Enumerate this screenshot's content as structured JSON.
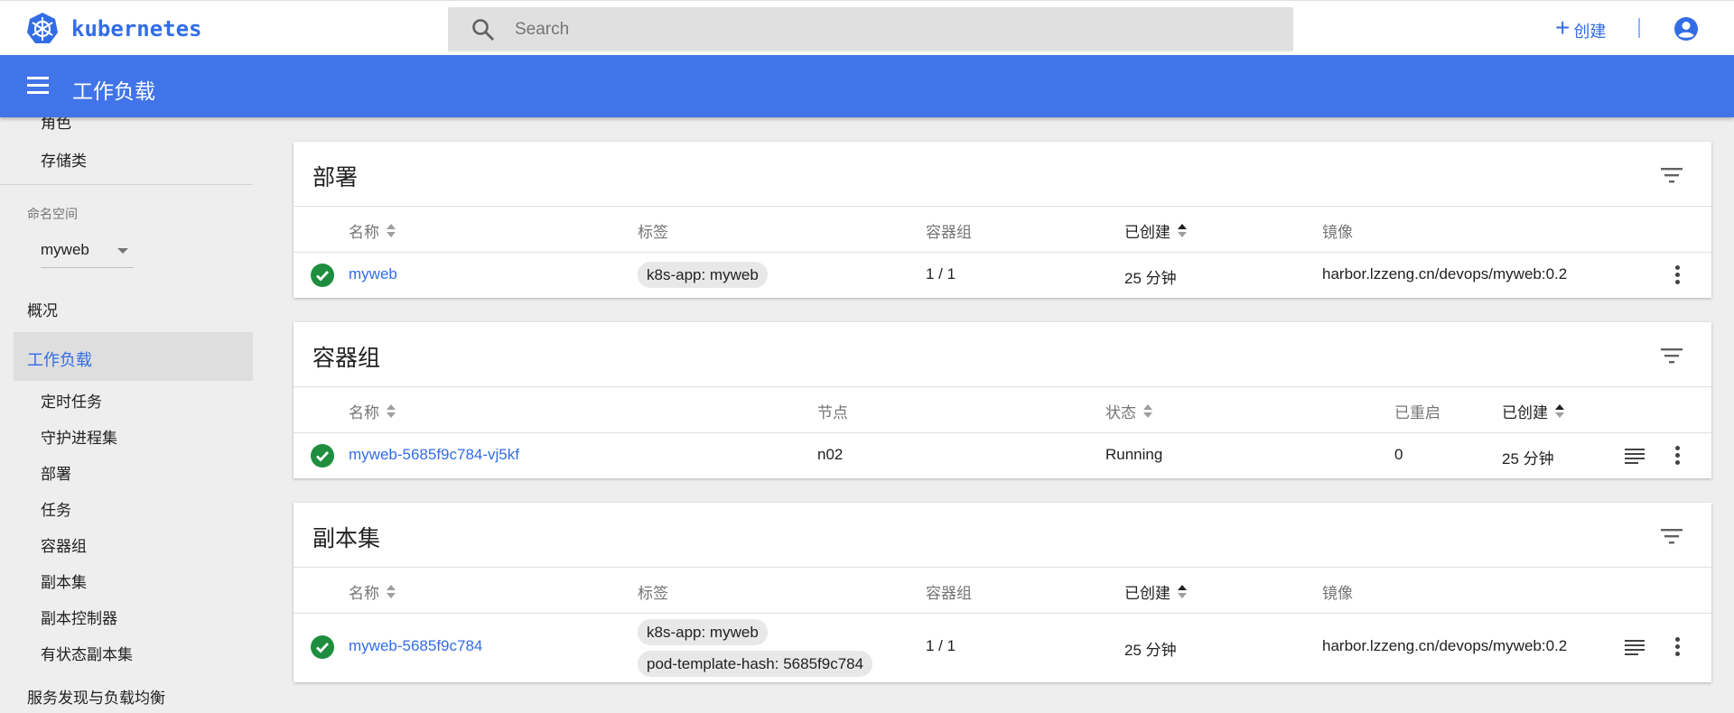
{
  "topbar": {
    "brand": "kubernetes",
    "search_placeholder": "Search",
    "create_label": "创建"
  },
  "appbar": {
    "title": "工作负载"
  },
  "sidebar": {
    "partial_top_item": "角色",
    "storage_class": "存储类",
    "namespace_label": "命名空间",
    "namespace_value": "myweb",
    "overview": "概况",
    "workloads": "工作负载",
    "workload_items": [
      "定时任务",
      "守护进程集",
      "部署",
      "任务",
      "容器组",
      "副本集",
      "副本控制器",
      "有状态副本集"
    ],
    "discovery": "服务发现与负载均衡"
  },
  "deployments": {
    "title": "部署",
    "headers": {
      "name": "名称",
      "labels": "标签",
      "pods": "容器组",
      "created": "已创建",
      "images": "镜像"
    },
    "rows": [
      {
        "name": "myweb",
        "labels": [
          "k8s-app: myweb"
        ],
        "pods": "1 / 1",
        "created": "25 分钟",
        "image": "harbor.lzzeng.cn/devops/myweb:0.2"
      }
    ]
  },
  "pods": {
    "title": "容器组",
    "headers": {
      "name": "名称",
      "node": "节点",
      "status": "状态",
      "restarts": "已重启",
      "created": "已创建"
    },
    "rows": [
      {
        "name": "myweb-5685f9c784-vj5kf",
        "node": "n02",
        "status": "Running",
        "restarts": "0",
        "created": "25 分钟"
      }
    ]
  },
  "replicasets": {
    "title": "副本集",
    "headers": {
      "name": "名称",
      "labels": "标签",
      "pods": "容器组",
      "created": "已创建",
      "images": "镜像"
    },
    "rows": [
      {
        "name": "myweb-5685f9c784",
        "labels": [
          "k8s-app: myweb",
          "pod-template-hash: 5685f9c784"
        ],
        "pods": "1 / 1",
        "created": "25 分钟",
        "image": "harbor.lzzeng.cn/devops/myweb:0.2"
      }
    ]
  },
  "colors": {
    "accent": "#326de6",
    "appbar": "#4174e8",
    "success": "#1e8e3e"
  }
}
